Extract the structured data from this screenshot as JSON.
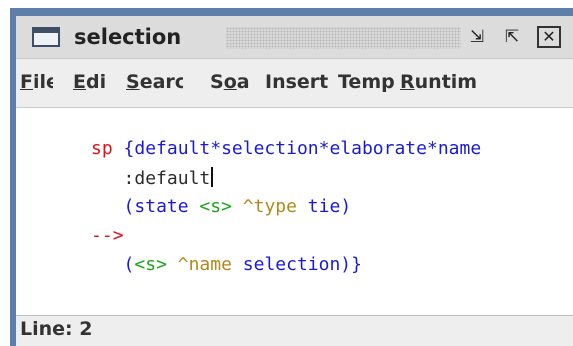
{
  "window": {
    "title": "selection",
    "controls": {
      "minimize": "⇲",
      "maximize": "⇱",
      "close": "✕"
    }
  },
  "menubar": {
    "items": [
      {
        "label": "File",
        "mnemonic_index": 0
      },
      {
        "label": "Edit",
        "mnemonic_index": 0
      },
      {
        "label": "Search",
        "mnemonic_index": 0
      },
      {
        "label": "Soar",
        "mnemonic_index": 1
      },
      {
        "label": "Insert",
        "mnemonic_index": null
      },
      {
        "label": "Templates",
        "mnemonic_index": null
      },
      {
        "label": "Runtime",
        "mnemonic_index": 0
      }
    ],
    "visible": [
      "File",
      "Edi",
      "Searc",
      "Soa",
      "Insert",
      "Temp",
      "Runtim"
    ]
  },
  "editor": {
    "lines": [
      [
        {
          "text": "sp ",
          "color": "red"
        },
        {
          "text": "{default*selection*elaborate*name",
          "color": "blue"
        }
      ],
      [
        {
          "text": "   :default",
          "color": "dark"
        }
      ],
      [
        {
          "text": "   (",
          "color": "blue"
        },
        {
          "text": "state ",
          "color": "blue"
        },
        {
          "text": "<s>",
          "color": "green"
        },
        {
          "text": " ^type",
          "color": "gold"
        },
        {
          "text": " tie)",
          "color": "blue"
        }
      ],
      [
        {
          "text": "-->",
          "color": "red"
        }
      ],
      [
        {
          "text": "   (",
          "color": "blue"
        },
        {
          "text": "<s>",
          "color": "green"
        },
        {
          "text": " ^name",
          "color": "gold"
        },
        {
          "text": " selection)}",
          "color": "blue"
        }
      ]
    ],
    "caret_line": 2
  },
  "status": {
    "text": "Line: 2"
  },
  "colors": {
    "frame": "#5f7fab",
    "red": "#e0101a",
    "blue": "#1a1ad6",
    "green": "#1aa51a",
    "gold": "#b08a1c",
    "dark": "#2b2b2b"
  }
}
